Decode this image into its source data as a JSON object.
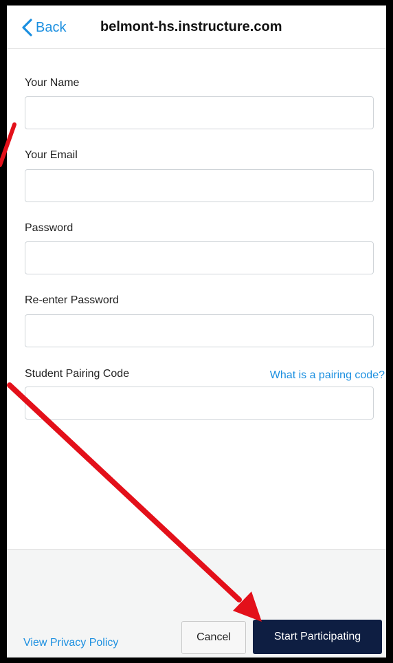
{
  "nav": {
    "back_label": "Back",
    "title": "belmont-hs.instructure.com"
  },
  "form": {
    "fields": [
      {
        "label": "Your Name",
        "value": "",
        "placeholder": ""
      },
      {
        "label": "Your Email",
        "value": "",
        "placeholder": ""
      },
      {
        "label": "Password",
        "value": "",
        "placeholder": ""
      },
      {
        "label": "Re-enter Password",
        "value": "",
        "placeholder": ""
      },
      {
        "label": "Student Pairing Code",
        "value": "",
        "placeholder": ""
      }
    ],
    "pairing_help_link": "What is a pairing code?"
  },
  "footer": {
    "privacy_link": "View Privacy Policy",
    "cancel_label": "Cancel",
    "start_label": "Start Participating"
  },
  "colors": {
    "link": "#1b8fe0",
    "primary_button": "#0e1e42",
    "annotation_arrow": "#e3101a"
  },
  "icons": {
    "back": "chevron-left-icon",
    "annotation": "red-arrow-icon"
  }
}
